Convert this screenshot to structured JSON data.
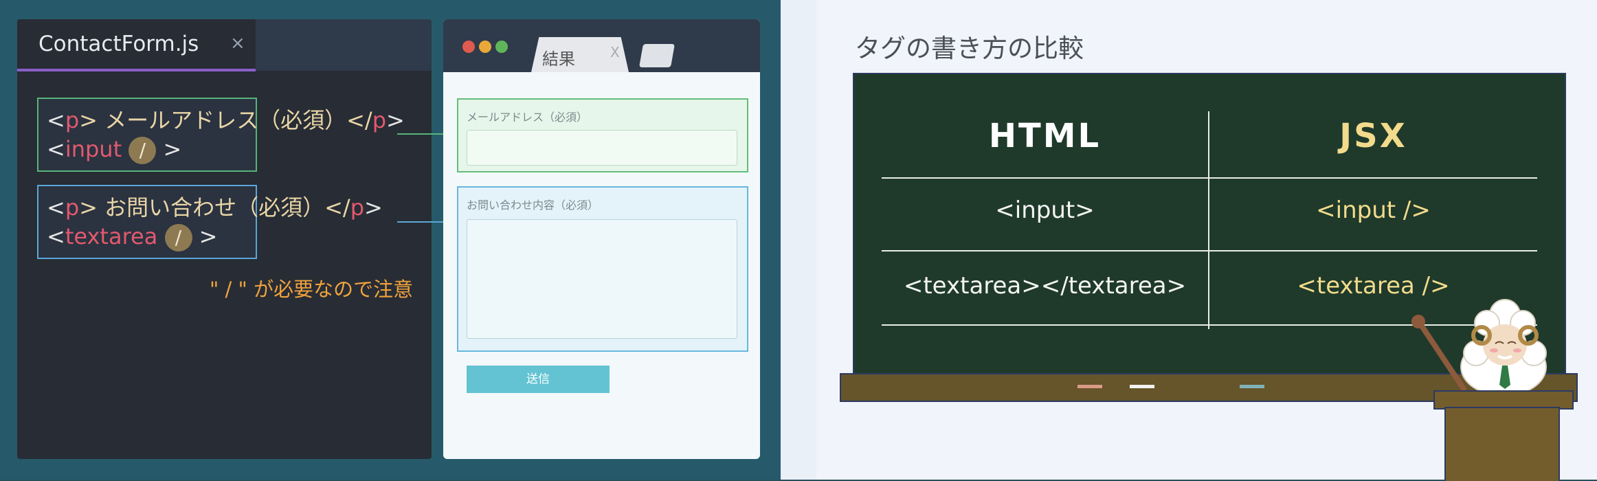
{
  "editor": {
    "tab_label": "ContactForm.js",
    "tab_close": "×",
    "code_block_1": {
      "line1": {
        "open": "<",
        "tag": "p",
        "mid": "> メールアドレス（必須）</",
        "tag2": "p",
        "close": ">"
      },
      "line2": {
        "open": "<",
        "tag": "input",
        "slash": "/",
        "close": ">"
      }
    },
    "code_block_2": {
      "line1": {
        "open": "<",
        "tag": "p",
        "mid": "> お問い合わせ（必須）</",
        "tag2": "p",
        "close": ">"
      },
      "line2": {
        "open": "<",
        "tag": "textarea",
        "slash": "/",
        "close": ">"
      }
    },
    "note": "\" / \" が必要なので注意"
  },
  "browser": {
    "tab_label": "結果",
    "tab_close": "X",
    "email_label": "メールアドレス（必須）",
    "inquiry_label": "お問い合わせ内容（必須）",
    "submit_label": "送信"
  },
  "comparison": {
    "title": "タグの書き方の比較",
    "header_html": "HTML",
    "header_jsx": "JSX",
    "rows": [
      {
        "html": "<input>",
        "jsx": "<input />"
      },
      {
        "html": "<textarea></textarea>",
        "jsx": "<textarea />"
      }
    ]
  },
  "colors": {
    "accent_green": "#56b57a",
    "accent_blue": "#5aa7d9",
    "tag_red": "#e25a6e",
    "note_orange": "#f0a33c",
    "jsx_yellow": "#f2db8c",
    "board_green": "#1f3a2a",
    "submit_teal": "#63c3d3"
  }
}
